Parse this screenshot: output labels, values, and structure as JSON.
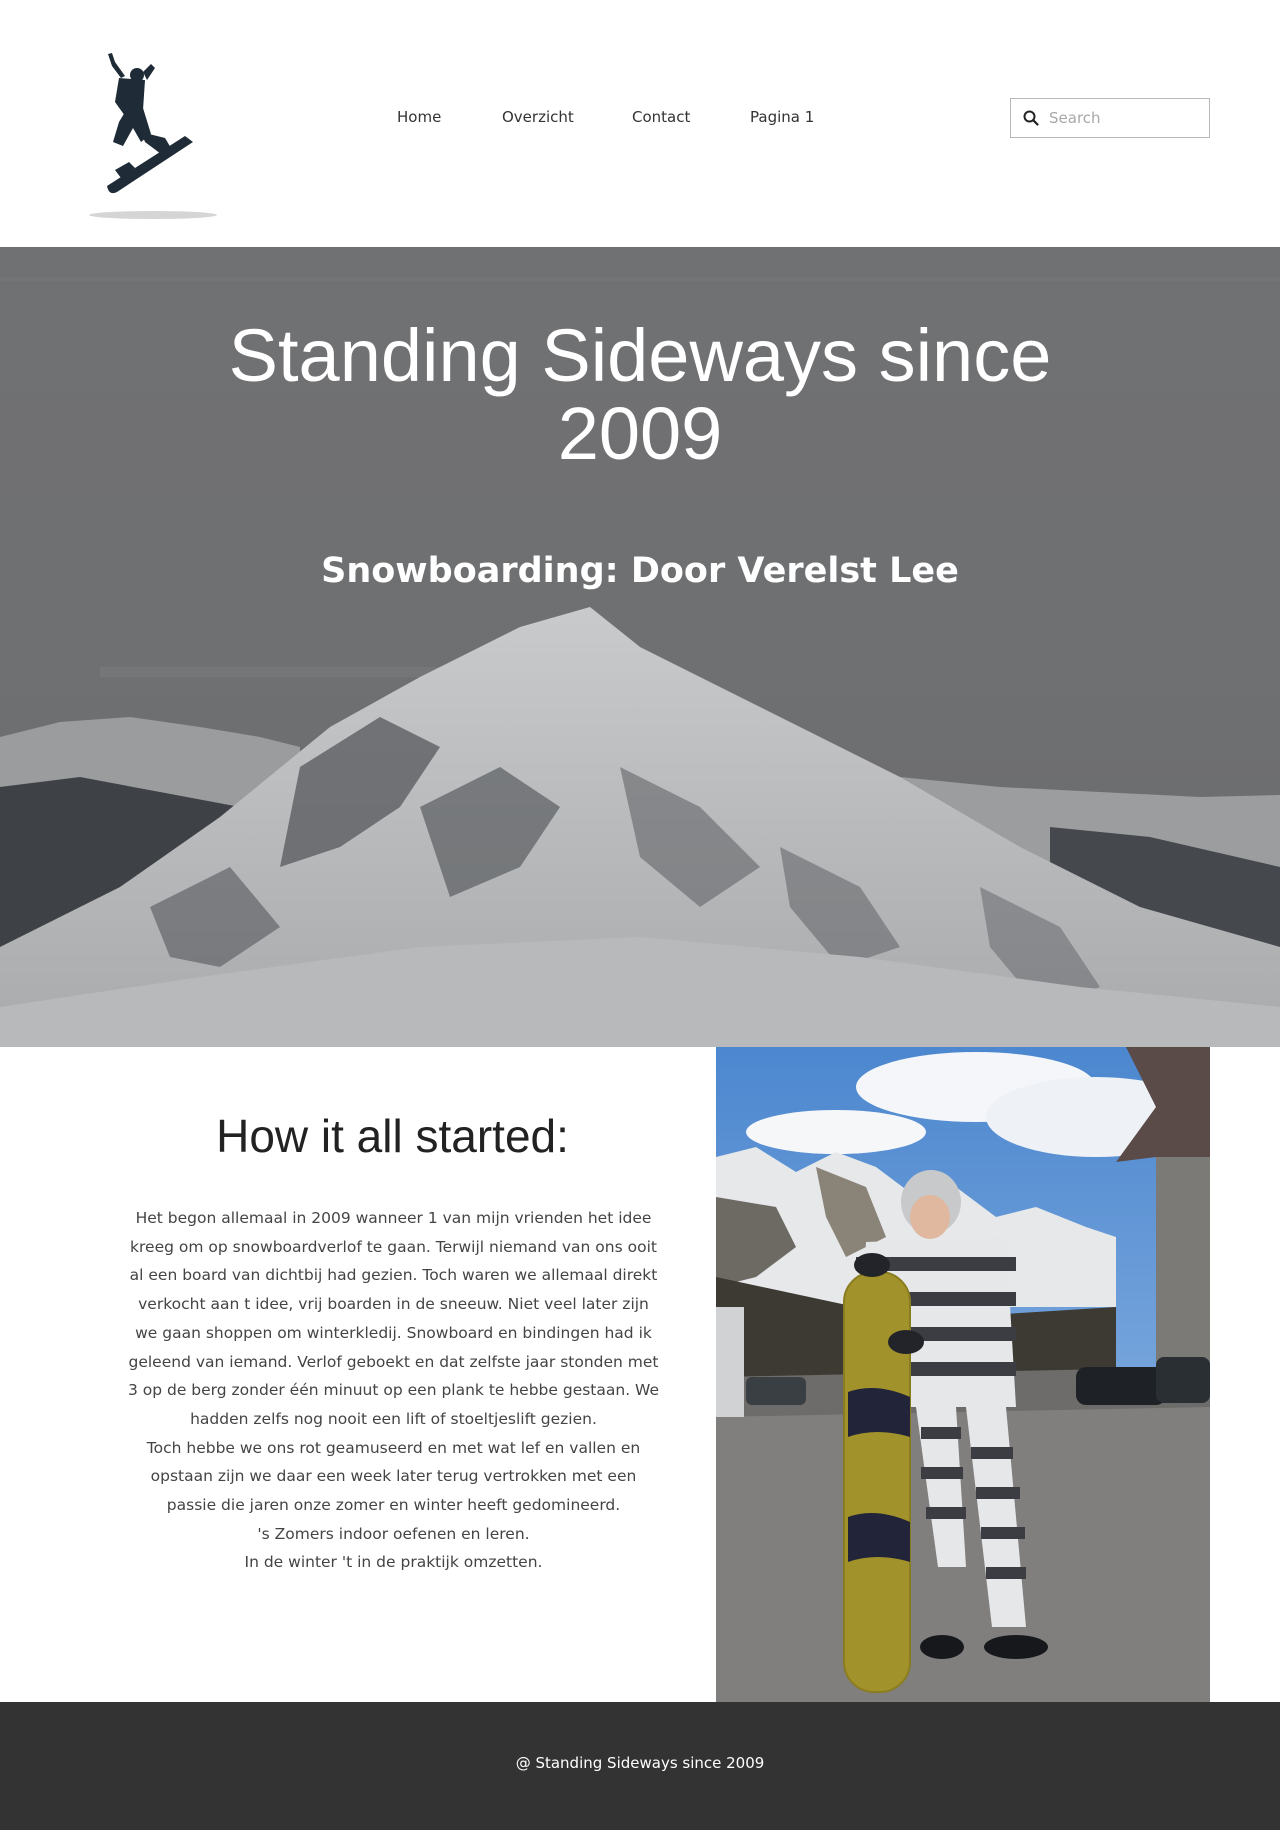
{
  "header": {
    "logo_icon": "snowboarder-logo-icon",
    "nav": {
      "home": "Home",
      "overzicht": "Overzicht",
      "contact": "Contact",
      "pagina1": "Pagina 1"
    },
    "search": {
      "placeholder": "Search",
      "icon": "search-icon"
    }
  },
  "hero": {
    "title": "Standing Sideways since 2009",
    "subtitle": "Snowboarding: Door Verelst Lee"
  },
  "story": {
    "heading": "How it all started:",
    "paragraphs": [
      "Het begon allemaal in 2009 wanneer 1 van mijn vrienden het idee kreeg om op snowboardverlof te gaan. Terwijl niemand van ons ooit al een board van dichtbij had gezien. Toch waren we allemaal direkt verkocht aan t idee, vrij boarden in de sneeuw. Niet veel later zijn we gaan shoppen om winterkledij. Snowboard en bindingen had ik geleend van iemand. Verlof geboekt en dat zelfste jaar stonden met 3 op de berg zonder één minuut op een plank te hebbe gestaan. We hadden zelfs nog nooit een lift of stoeltjeslift gezien.",
      "Toch hebbe we ons rot geamuseerd en met wat lef en vallen en opstaan zijn we daar een week later terug vertrokken met een passie die jaren onze zomer en winter heeft gedomineerd.",
      "'s Zomers indoor oefenen en leren.",
      "In de winter 't in de praktijk omzetten."
    ]
  },
  "footer": {
    "text": "@ Standing Sideways since 2009"
  },
  "colors": {
    "footer_bg": "#333333",
    "hero_overlay": "#6d6e70",
    "text": "#333333"
  }
}
